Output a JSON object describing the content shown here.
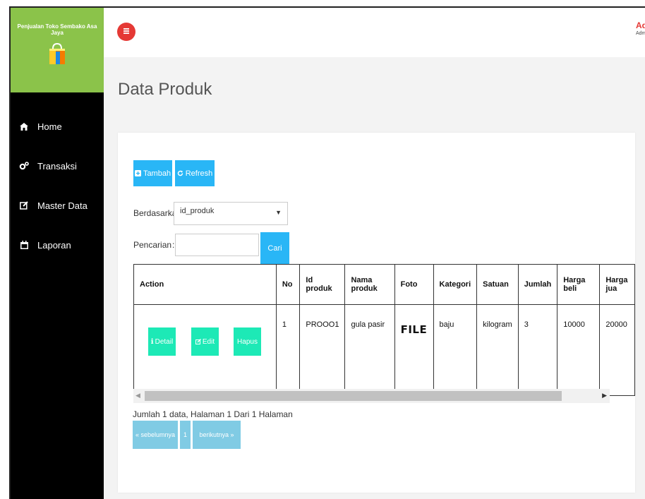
{
  "brand": {
    "title": "Penjualan Toko Sembako Asa Jaya"
  },
  "nav": [
    {
      "label": "Home",
      "icon": "home-icon"
    },
    {
      "label": "Transaksi",
      "icon": "cogs-icon"
    },
    {
      "label": "Master Data",
      "icon": "edit-icon"
    },
    {
      "label": "Laporan",
      "icon": "calendar-icon"
    }
  ],
  "user": {
    "name": "Adi",
    "role": "Adm"
  },
  "page": {
    "title": "Data Produk"
  },
  "toolbar": {
    "tambah": "Tambah",
    "refresh": "Refresh"
  },
  "filter": {
    "by_label": "Berdasarkan:",
    "by_value": "id_produk",
    "search_label": "Pencarian",
    "search_sep": ":",
    "search_value": "",
    "search_button": "Cari"
  },
  "table": {
    "headers": [
      "Action",
      "No",
      "Id produk",
      "Nama produk",
      "Foto",
      "Kategori",
      "Satuan",
      "Jumlah",
      "Harga beli",
      "Harga jua"
    ],
    "rows": [
      {
        "actions": [
          "Detail",
          "Edit",
          "Hapus"
        ],
        "no": "1",
        "id_produk": "PROOO1",
        "nama_produk": "gula pasir",
        "foto": "FILE",
        "kategori": "baju",
        "satuan": "kilogram",
        "jumlah": "3",
        "harga_beli": "10000",
        "harga_jual": "20000"
      }
    ]
  },
  "pagination": {
    "info": "Jumlah 1 data, Halaman 1 Dari 1 Halaman",
    "prev": "« sebelumnya",
    "page": "1",
    "next": "berikutnya »"
  },
  "colors": {
    "sidebar": "#000000",
    "brand_bg": "#8bc34a",
    "accent": "#29b6f6",
    "action_btn": "#1de9b6",
    "menu_btn": "#e53935"
  }
}
